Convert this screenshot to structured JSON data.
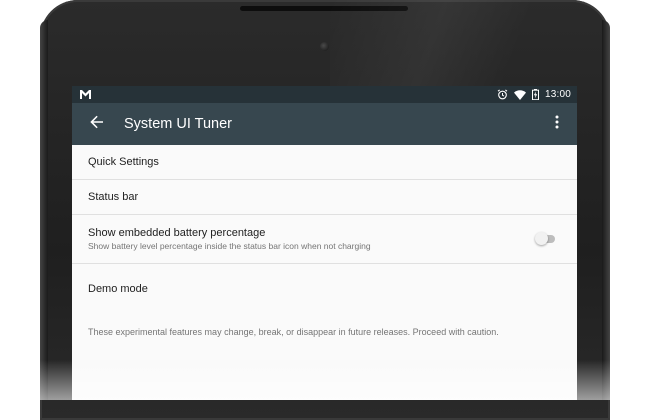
{
  "status_bar": {
    "notification_icon": "gmail-m-icon",
    "alarm_icon": "alarm-clock-icon",
    "wifi_icon": "wifi-icon",
    "battery_icon": "battery-charging-icon",
    "time": "13:00"
  },
  "app_bar": {
    "back_icon": "arrow-back-icon",
    "title": "System UI Tuner",
    "menu_icon": "more-vert-icon"
  },
  "settings": {
    "quick_settings": "Quick Settings",
    "status_bar": "Status bar",
    "battery_percentage": {
      "title": "Show embedded battery percentage",
      "summary": "Show battery level percentage inside the status bar icon when not charging",
      "enabled": false
    },
    "demo_mode": "Demo mode"
  },
  "footer": {
    "warning": "These experimental features may change, break, or disappear in future releases. Proceed with caution."
  },
  "colors": {
    "status_bar_bg": "#263238",
    "app_bar_bg": "#37474f",
    "screen_bg": "#fafafa"
  }
}
